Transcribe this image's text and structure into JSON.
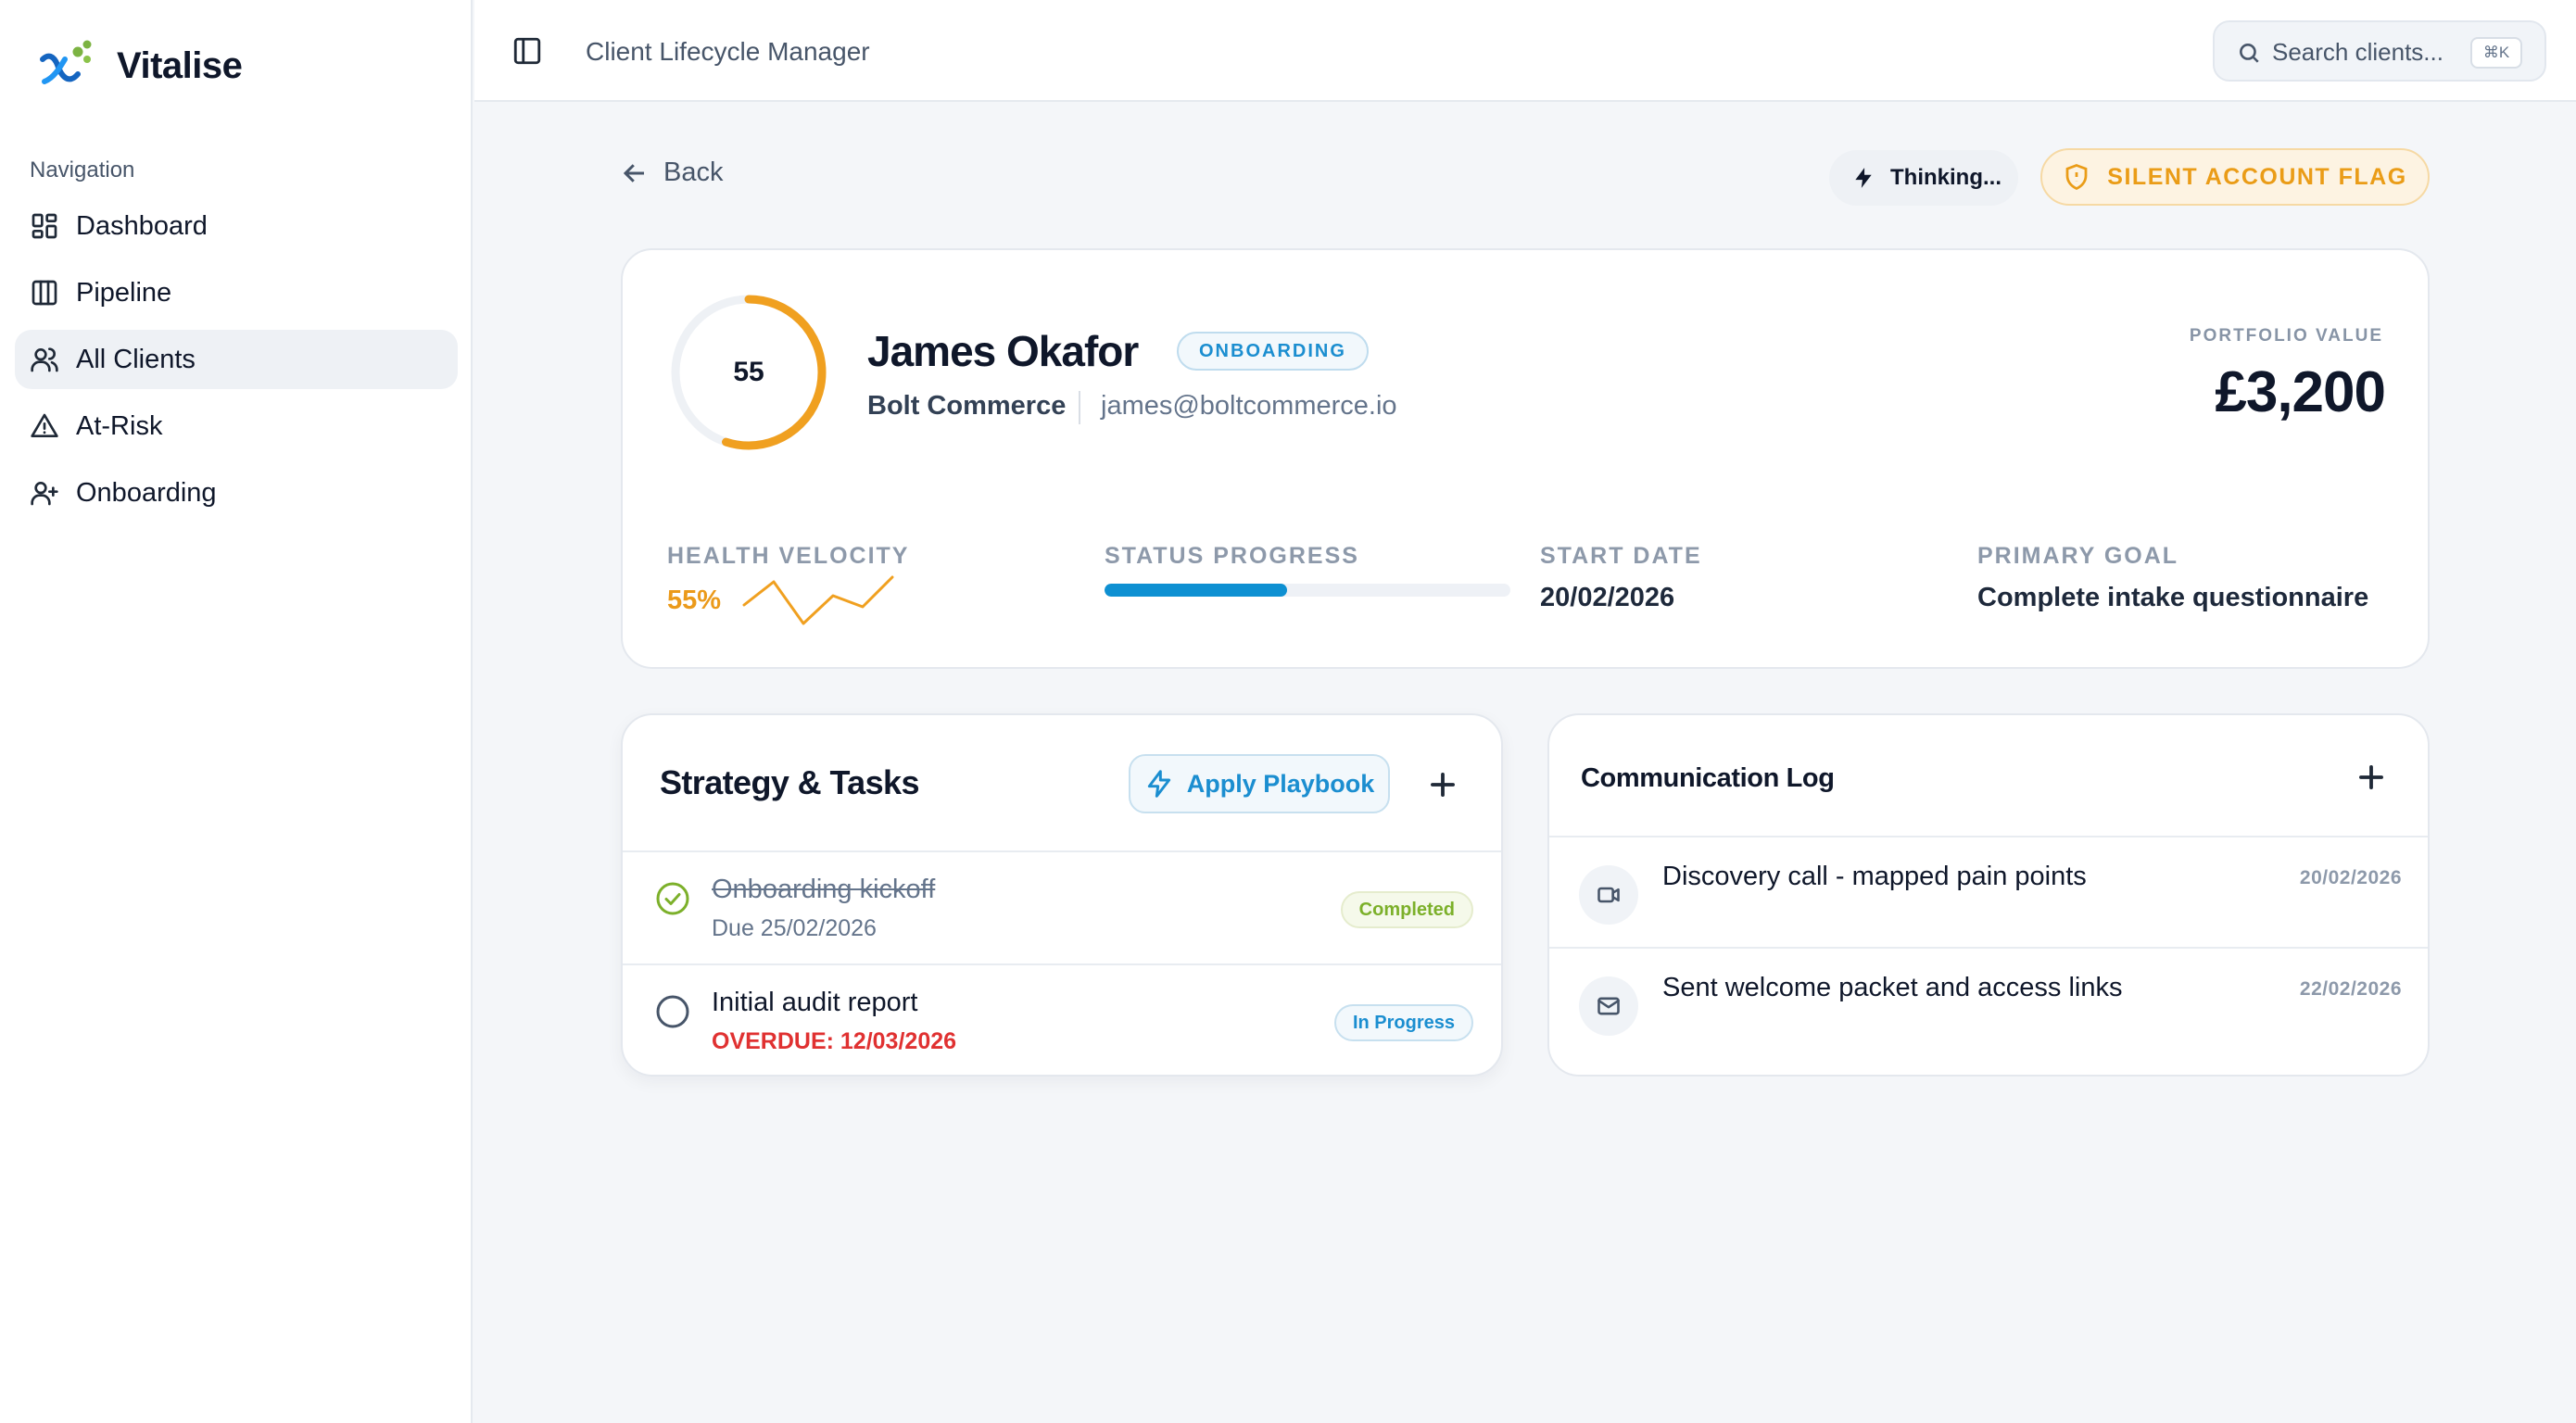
{
  "app": {
    "brand_name": "Vitalise",
    "top_title": "Client Lifecycle Manager"
  },
  "search": {
    "placeholder": "Search clients...",
    "shortcut": "⌘K",
    "icon": "search-icon"
  },
  "sidebar": {
    "heading": "Navigation",
    "items": [
      {
        "label": "Dashboard",
        "icon": "dashboard-icon",
        "active": false
      },
      {
        "label": "Pipeline",
        "icon": "columns-icon",
        "active": false
      },
      {
        "label": "All Clients",
        "icon": "users-icon",
        "active": true
      },
      {
        "label": "At-Risk",
        "icon": "warning-icon",
        "active": false
      },
      {
        "label": "Onboarding",
        "icon": "user-plus-icon",
        "active": false
      }
    ]
  },
  "actions": {
    "back_label": "Back",
    "thinking_label": "Thinking...",
    "flag_label": "SILENT ACCOUNT FLAG"
  },
  "client": {
    "health_score": "55",
    "name": "James Okafor",
    "stage": "ONBOARDING",
    "company": "Bolt Commerce",
    "email": "james@boltcommerce.io",
    "portfolio_label": "PORTFOLIO VALUE",
    "portfolio_value": "£3,200"
  },
  "metrics": {
    "velocity_label": "HEALTH VELOCITY",
    "velocity_value": "55%",
    "sparkline": [
      30,
      55,
      10,
      40,
      28,
      60
    ],
    "progress_label": "STATUS PROGRESS",
    "progress_fraction": 0.45,
    "start_label": "START DATE",
    "start_value": "20/02/2026",
    "goal_label": "PRIMARY GOAL",
    "goal_value": "Complete intake questionnaire"
  },
  "tasks": {
    "title": "Strategy & Tasks",
    "playbook_label": "Apply Playbook",
    "items": [
      {
        "title": "Onboarding kickoff",
        "due": "Due 25/02/2026",
        "status": "Completed"
      },
      {
        "title": "Initial audit report",
        "due": "OVERDUE: 12/03/2026",
        "status": "In Progress"
      }
    ]
  },
  "comms": {
    "title": "Communication Log",
    "items": [
      {
        "text": "Discovery call - mapped pain points",
        "date": "20/02/2026",
        "icon": "video-icon"
      },
      {
        "text": "Sent welcome packet and access links",
        "date": "22/02/2026",
        "icon": "mail-icon"
      }
    ]
  },
  "colors": {
    "accent_blue": "#1b8ed0",
    "accent_orange": "#ea9c17",
    "success_green": "#7cb02a",
    "danger_red": "#e03131"
  }
}
